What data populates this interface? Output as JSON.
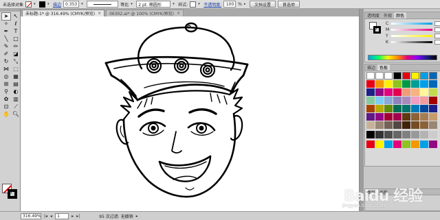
{
  "control_bar": {
    "selection_status": "未选择对象",
    "stroke_label": "描边",
    "stroke_weight": "0.353",
    "uniform_label": "等比",
    "brush_size": "2 pt. 椭圆形",
    "style_label": "样式:",
    "opacity_label": "不透明度:",
    "opacity_value": "100",
    "opacity_unit": "%",
    "document_setup_button": "文档设置",
    "preferences_button": "首选项"
  },
  "tabs": [
    {
      "label": "未标题-1* @ 316.49% (CMYK/预览)",
      "close": "×",
      "active": true
    },
    {
      "label": "06302.ai* @ 100% (CMYK/预览)",
      "close": "×",
      "active": false
    }
  ],
  "tools": [
    "selection-tool",
    "direct-selection-tool",
    "magic-wand-tool",
    "lasso-tool",
    "pen-tool",
    "type-tool",
    "line-tool",
    "rectangle-tool",
    "paintbrush-tool",
    "pencil-tool",
    "blob-brush-tool",
    "eraser-tool",
    "rotate-tool",
    "scale-tool",
    "width-tool",
    "free-transform-tool",
    "shape-builder-tool",
    "perspective-grid-tool",
    "mesh-tool",
    "gradient-tool",
    "eyedropper-tool",
    "blend-tool",
    "symbol-sprayer-tool",
    "column-graph-tool",
    "artboard-tool",
    "slice-tool",
    "hand-tool",
    "zoom-tool"
  ],
  "color_panel": {
    "tabs": [
      "透明度",
      "外观",
      "颜色"
    ],
    "active_tab": "颜色",
    "channels": [
      {
        "name": "C",
        "value": "",
        "bar": "linear-gradient(90deg,#fff,#00a0e9)"
      },
      {
        "name": "M",
        "value": "",
        "bar": "linear-gradient(90deg,#fff,#e4007f)"
      },
      {
        "name": "Y",
        "value": "",
        "bar": "linear-gradient(90deg,#fff,#fff100)"
      },
      {
        "name": "K",
        "value": "",
        "bar": "linear-gradient(90deg,#fff,#000)"
      }
    ],
    "unit": "%"
  },
  "swatch_panel": {
    "tabs": [
      "描边",
      "色板"
    ],
    "active_tab": "色板",
    "top_row": [
      "#ffffff",
      "#ffffff",
      "#ffffff",
      "#000000",
      "#e60012",
      "#fff100",
      "#00a0e9",
      "#0068b7"
    ],
    "grid": [
      "#e60012",
      "#f39800",
      "#fff100",
      "#8fc31f",
      "#009944",
      "#009e96",
      "#00a0e9",
      "#0068b7",
      "#1d2088",
      "#920783",
      "#e4007f",
      "#e5004f",
      "#f29b76",
      "#f6b37f",
      "#fff799",
      "#c3d94e",
      "#84cca0",
      "#7ecef4",
      "#88abda",
      "#8f82bc",
      "#aa89bd",
      "#f19ec2",
      "#f29c9f",
      "#a40000",
      "#a84200",
      "#b7aa00",
      "#638c0b",
      "#006e54",
      "#00736d",
      "#007ab7",
      "#00479d",
      "#1d2088",
      "#601986",
      "#920783",
      "#a40035",
      "#a4004f",
      "#603813",
      "#8c6239",
      "#a67c52",
      "#c69c6d",
      "#c7b299",
      "#998675",
      "#736357",
      "#534741",
      "#42210b",
      "#754c24",
      "#8c6239",
      "#998675"
    ],
    "gray_row": [
      "#000000",
      "#333333",
      "#4d4d4d",
      "#666666",
      "#808080",
      "#999999",
      "#b3b3b3",
      "#cccccc"
    ],
    "bright_row": [
      "#e60012",
      "#fff100",
      "#00a0e9",
      "#e4007f",
      "#8fc31f",
      "#f39800",
      "#00a0e9",
      "#920783"
    ]
  },
  "layers_panel": {
    "tabs": [
      "图层",
      "画板"
    ]
  },
  "status_bar": {
    "zoom": "316.49%",
    "artboard": "1",
    "info": "95 次过滤: 无撤销"
  },
  "watermark": {
    "brand": "Baidu 经验",
    "url": "jingyan.baidu.com"
  }
}
